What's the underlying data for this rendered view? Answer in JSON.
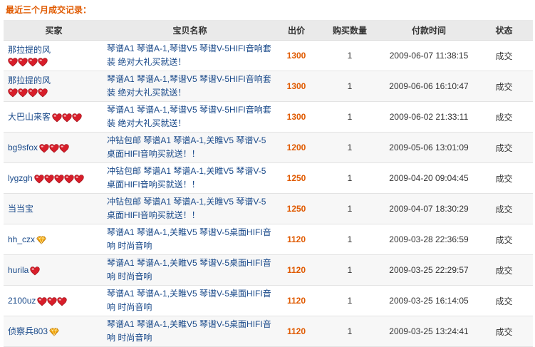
{
  "title": "最近三个月成交记录：",
  "columns": {
    "buyer": "买家",
    "item": "宝贝名称",
    "price": "出价",
    "qty": "购买数量",
    "time": "付款时间",
    "status": "状态"
  },
  "colors": {
    "title": "#e05a00",
    "price": "#e05a00",
    "link": "#1a4a8a",
    "heart": "#d81e2a",
    "diamond": "#f0a000"
  },
  "rows": [
    {
      "buyer": "那拉提的风",
      "badge": "heart",
      "badge_count": 4,
      "badge_newline": true,
      "item": "琴谱A1 琴谱A-1,琴谱V5 琴谱V-5HIFI音响套装 绝对大礼买就送！",
      "price": "1300",
      "qty": "1",
      "time": "2009-06-07 11:38:15",
      "status": "成交"
    },
    {
      "buyer": "那拉提的风",
      "badge": "heart",
      "badge_count": 4,
      "badge_newline": true,
      "item": "琴谱A1 琴谱A-1,琴谱V5 琴谱V-5HIFI音响套装 绝对大礼买就送！",
      "price": "1300",
      "qty": "1",
      "time": "2009-06-06 16:10:47",
      "status": "成交"
    },
    {
      "buyer": "大巴山来客",
      "badge": "heart",
      "badge_count": 3,
      "badge_newline": false,
      "item": "琴谱A1 琴谱A-1,琴谱V5 琴谱V-5HIFI音响套装 绝对大礼买就送！",
      "price": "1300",
      "qty": "1",
      "time": "2009-06-02 21:33:11",
      "status": "成交"
    },
    {
      "buyer": "bg9sfox",
      "badge": "heart",
      "badge_count": 3,
      "badge_newline": false,
      "item": "冲钻包邮 琴谱A1 琴谱A-1,关睢V5 琴谱V-5桌面HIFI音响买就送！！",
      "price": "1200",
      "qty": "1",
      "time": "2009-05-06 13:01:09",
      "status": "成交"
    },
    {
      "buyer": "lygzgh",
      "badge": "heart",
      "badge_count": 5,
      "badge_newline": false,
      "item": "冲钻包邮 琴谱A1 琴谱A-1,关睢V5 琴谱V-5桌面HIFI音响买就送！！",
      "price": "1250",
      "qty": "1",
      "time": "2009-04-20 09:04:45",
      "status": "成交"
    },
    {
      "buyer": "当当宝",
      "badge": "none",
      "badge_count": 0,
      "badge_newline": false,
      "item": "冲钻包邮 琴谱A1 琴谱A-1,关睢V5 琴谱V-5桌面HIFI音响买就送！！",
      "price": "1250",
      "qty": "1",
      "time": "2009-04-07 18:30:29",
      "status": "成交"
    },
    {
      "buyer": "hh_czx",
      "badge": "diamond",
      "badge_count": 1,
      "badge_newline": false,
      "item": "琴谱A1 琴谱A-1,关睢V5 琴谱V-5桌面HIFI音响 时尚音响",
      "price": "1120",
      "qty": "1",
      "time": "2009-03-28 22:36:59",
      "status": "成交"
    },
    {
      "buyer": "hurila",
      "badge": "heart",
      "badge_count": 1,
      "badge_newline": false,
      "item": "琴谱A1 琴谱A-1,关睢V5 琴谱V-5桌面HIFI音响 时尚音响",
      "price": "1120",
      "qty": "1",
      "time": "2009-03-25 22:29:57",
      "status": "成交"
    },
    {
      "buyer": "2100uz",
      "badge": "heart",
      "badge_count": 3,
      "badge_newline": false,
      "item": "琴谱A1 琴谱A-1,关睢V5 琴谱V-5桌面HIFI音响 时尚音响",
      "price": "1120",
      "qty": "1",
      "time": "2009-03-25 16:14:05",
      "status": "成交"
    },
    {
      "buyer": "侦察兵803",
      "badge": "diamond",
      "badge_count": 1,
      "badge_newline": false,
      "item": "琴谱A1 琴谱A-1,关睢V5 琴谱V-5桌面HIFI音响 时尚音响",
      "price": "1120",
      "qty": "1",
      "time": "2009-03-25 13:24:41",
      "status": "成交"
    }
  ]
}
